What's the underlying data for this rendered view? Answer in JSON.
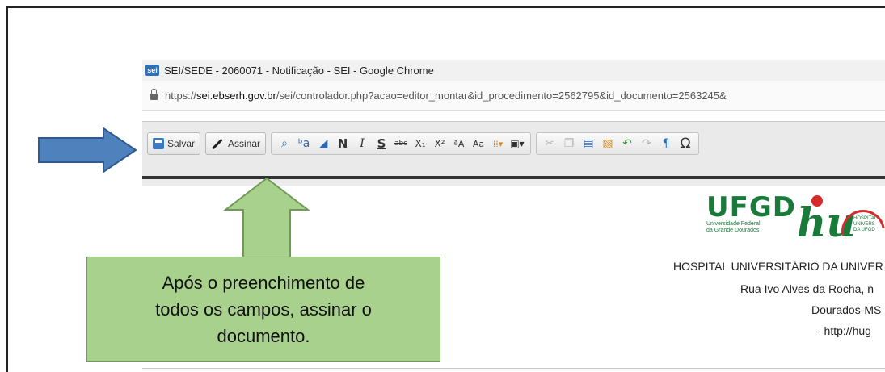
{
  "window": {
    "title": "SEI/SEDE - 2060071 - Notificação - SEI - Google Chrome",
    "logo_label": "sei",
    "url_prefix": "https://",
    "url_domain": "sei.ebserh.gov.br",
    "url_path": "/sei/controlador.php?acao=editor_montar&id_procedimento=2562795&id_documento=2563245&"
  },
  "toolbar": {
    "save_label": "Salvar",
    "sign_label": "Assinar",
    "icons": [
      {
        "name": "find-icon",
        "glyph": "⌕"
      },
      {
        "name": "replace-icon",
        "glyph": "ᵇa"
      },
      {
        "name": "eraser-icon",
        "glyph": "◢"
      },
      {
        "name": "bold-icon",
        "glyph": "N"
      },
      {
        "name": "italic-icon",
        "glyph": "I"
      },
      {
        "name": "underline-icon",
        "glyph": "S"
      },
      {
        "name": "strike-icon",
        "glyph": "abc"
      },
      {
        "name": "subscript-icon",
        "glyph": "X₁"
      },
      {
        "name": "superscript-icon",
        "glyph": "X²"
      },
      {
        "name": "text-color-icon",
        "glyph": "ªA"
      },
      {
        "name": "bg-color-icon",
        "glyph": "Aa"
      },
      {
        "name": "style-icon",
        "glyph": "⁞⁞▾"
      },
      {
        "name": "block-icon",
        "glyph": "▣▾"
      }
    ],
    "icons2": [
      {
        "name": "cut-icon",
        "glyph": "✂"
      },
      {
        "name": "copy-icon",
        "glyph": "❐"
      },
      {
        "name": "paste-icon",
        "glyph": "▤"
      },
      {
        "name": "paste-word-icon",
        "glyph": "▧"
      },
      {
        "name": "undo-icon",
        "glyph": "↶"
      },
      {
        "name": "redo-icon",
        "glyph": "↷"
      },
      {
        "name": "pilcrow-icon",
        "glyph": "¶"
      },
      {
        "name": "omega-icon",
        "glyph": "Ω"
      }
    ]
  },
  "document": {
    "ufgd": "UFGD",
    "ufgd_sub1": "Universidade Federal",
    "ufgd_sub2": "da Grande Dourados",
    "hu": "hu",
    "hu_side1": "HOSPITAL",
    "hu_side2": "UNIVERS",
    "hu_side3": "DA UFGD",
    "line1": "HOSPITAL UNIVERSITÁRIO DA UNIVER",
    "line2": "Rua Ivo Alves da Rocha, n",
    "line3": "Dourados-MS",
    "line4": "- http://hug"
  },
  "callout": {
    "text_line1": "Após o preenchimento de",
    "text_line2": "todos os campos, assinar o",
    "text_line3": "documento."
  },
  "colors": {
    "arrow_blue": "#4f81bd",
    "arrow_green": "#a9d18e",
    "brand_green": "#1a7a3a",
    "brand_red": "#d82a2a"
  }
}
